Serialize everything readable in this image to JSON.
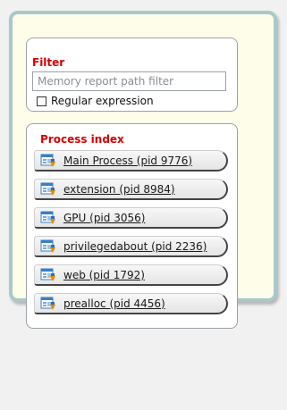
{
  "filter": {
    "title": "Filter",
    "placeholder": "Memory report path filter",
    "value": "",
    "regex_label": "Regular expression",
    "regex_checked": false
  },
  "process_index": {
    "title": "Process index",
    "items": [
      {
        "label": "Main Process (pid 9776)"
      },
      {
        "label": "extension (pid 8984)"
      },
      {
        "label": "GPU (pid 3056)"
      },
      {
        "label": "privilegedabout (pid 2236)"
      },
      {
        "label": "web (pid 1792)"
      },
      {
        "label": "prealloc (pid 4456)"
      }
    ]
  },
  "colors": {
    "accent_title": "#d40000",
    "panel_background": "#fdfde9",
    "panel_border": "#a9c8cc"
  },
  "icons": {
    "process_item": "process-window-icon"
  }
}
